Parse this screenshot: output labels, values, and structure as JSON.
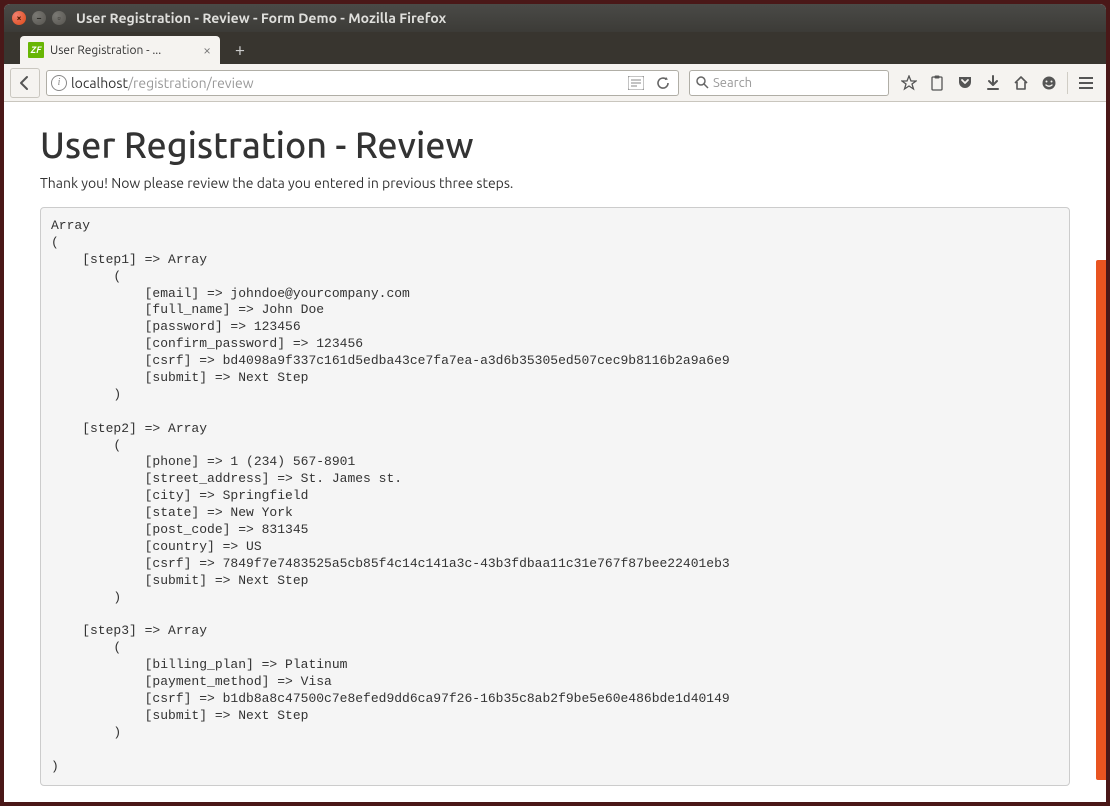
{
  "window": {
    "title": "User Registration - Review - Form Demo - Mozilla Firefox"
  },
  "tab": {
    "label": "User Registration - ..."
  },
  "url": {
    "host": "localhost",
    "path": "/registration/review"
  },
  "search": {
    "placeholder": "Search"
  },
  "page": {
    "heading": "User Registration - Review",
    "lead": "Thank you! Now please review the data you entered in previous three steps."
  },
  "dump": {
    "step1": {
      "email": "johndoe@yourcompany.com",
      "full_name": "John Doe",
      "password": "123456",
      "confirm_password": "123456",
      "csrf": "bd4098a9f337c161d5edba43ce7fa7ea-a3d6b35305ed507cec9b8116b2a9a6e9",
      "submit": "Next Step"
    },
    "step2": {
      "phone": "1 (234) 567-8901",
      "street_address": "St. James st.",
      "city": "Springfield",
      "state": "New York",
      "post_code": "831345",
      "country": "US",
      "csrf": "7849f7e7483525a5cb85f4c14c141a3c-43b3fdbaa11c31e767f87bee22401eb3",
      "submit": "Next Step"
    },
    "step3": {
      "billing_plan": "Platinum",
      "payment_method": "Visa",
      "csrf": "b1db8a8c47500c7e8efed9dd6ca97f26-16b35c8ab2f9be5e60e486bde1d40149",
      "submit": "Next Step"
    }
  }
}
